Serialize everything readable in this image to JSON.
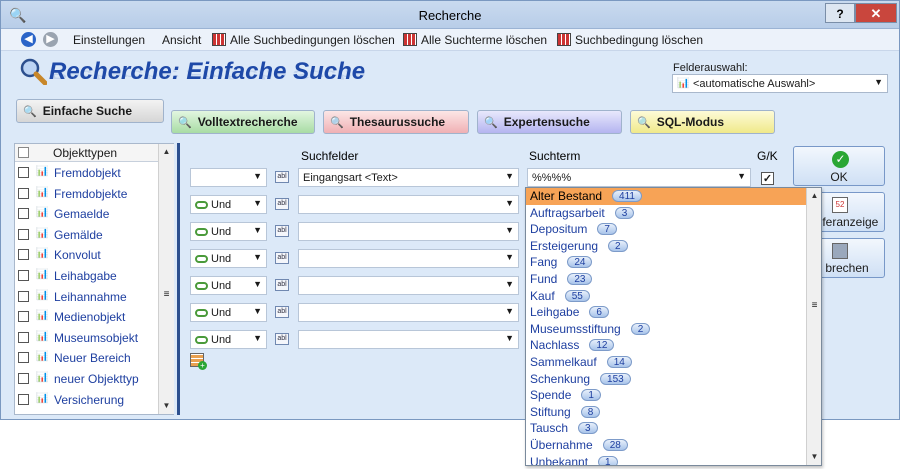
{
  "window": {
    "title": "Recherche",
    "help_label": "?",
    "close_label": "✕"
  },
  "menu": {
    "settings": "Einstellungen",
    "view": "Ansicht",
    "clear_all_conditions": "Alle Suchbedingungen löschen",
    "clear_all_terms": "Alle Suchterme löschen",
    "clear_condition": "Suchbedingung löschen"
  },
  "header": {
    "title": "Recherche: Einfache Suche"
  },
  "field_selection": {
    "label": "Felderauswahl:",
    "value": "<automatische Auswahl>"
  },
  "tabs": {
    "simple": "Einfache Suche",
    "fulltext": "Volltextrecherche",
    "thesaurus": "Thesaurussuche",
    "expert": "Expertensuche",
    "sql": "SQL-Modus"
  },
  "object_types": {
    "header": "Objekttypen",
    "items": [
      "Fremdobjekt",
      "Fremdobjekte",
      "Gemaelde",
      "Gemälde",
      "Konvolut",
      "Leihabgabe",
      "Leihannahme",
      "Medienobjekt",
      "Museumsobjekt",
      "Neuer Bereich",
      "neuer Objekttyp",
      "Versicherung"
    ]
  },
  "columns": {
    "fields": "Suchfelder",
    "term": "Suchterm",
    "gk": "G/K"
  },
  "rows": [
    {
      "operator": "",
      "field": "Eingangsart <Text>",
      "term": "%%%%",
      "gk_checked": "✓"
    },
    {
      "operator": "Und",
      "field": "",
      "term": ""
    },
    {
      "operator": "Und",
      "field": "",
      "term": ""
    },
    {
      "operator": "Und",
      "field": "",
      "term": ""
    },
    {
      "operator": "Und",
      "field": "",
      "term": ""
    },
    {
      "operator": "Und",
      "field": "",
      "term": ""
    },
    {
      "operator": "Und",
      "field": "",
      "term": ""
    }
  ],
  "buttons": {
    "ok": "OK",
    "display": "eferanzeige",
    "cancel": "brechen"
  },
  "dropdown": {
    "items": [
      {
        "label": "Alter Bestand",
        "count": "411"
      },
      {
        "label": "Auftragsarbeit",
        "count": "3"
      },
      {
        "label": "Depositum",
        "count": "7"
      },
      {
        "label": "Ersteigerung",
        "count": "2"
      },
      {
        "label": "Fang",
        "count": "24"
      },
      {
        "label": "Fund",
        "count": "23"
      },
      {
        "label": "Kauf",
        "count": "55"
      },
      {
        "label": "Leihgabe",
        "count": "6"
      },
      {
        "label": "Museumsstiftung",
        "count": "2"
      },
      {
        "label": "Nachlass",
        "count": "12"
      },
      {
        "label": "Sammelkauf",
        "count": "14"
      },
      {
        "label": "Schenkung",
        "count": "153"
      },
      {
        "label": "Spende",
        "count": "1"
      },
      {
        "label": "Stiftung",
        "count": "8"
      },
      {
        "label": "Tausch",
        "count": "3"
      },
      {
        "label": "Übernahme",
        "count": "28"
      },
      {
        "label": "Unbekannt",
        "count": "1"
      }
    ]
  },
  "icons": {
    "app": "magnifier-icon",
    "back": "back-arrow-icon",
    "forward": "forward-arrow-icon",
    "clear": "table-clear-icon",
    "object": "object-type-icon",
    "text_type": "text-type-icon",
    "link": "link-icon",
    "add_row": "add-row-icon",
    "ok": "check-icon"
  },
  "colors": {
    "accent": "#1e49a8",
    "selected_item": "#f7a356",
    "close_button": "#c9463d",
    "ok_check": "#2aa634"
  }
}
